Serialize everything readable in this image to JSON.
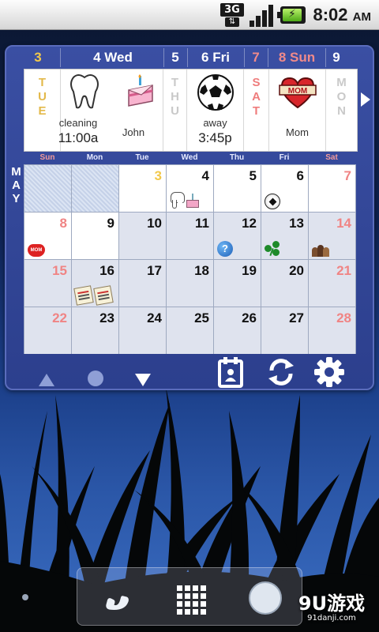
{
  "status_bar": {
    "network": "3G",
    "clock_time": "8:02",
    "clock_ampm": "AM"
  },
  "widget": {
    "day_headers": [
      {
        "label": "3",
        "style": "hl"
      },
      {
        "label": "4 Wed",
        "style": "normal"
      },
      {
        "label": "5",
        "style": "normal"
      },
      {
        "label": "6 Fri",
        "style": "normal"
      },
      {
        "label": "7",
        "style": "red"
      },
      {
        "label": "8 Sun",
        "style": "red"
      },
      {
        "label": "9",
        "style": "normal"
      }
    ],
    "strip": {
      "tue": {
        "day_vertical": "TUE"
      },
      "wed": {
        "icon": "tooth-icon",
        "label": "cleaning",
        "time": "11:00a",
        "second_icon": "birthday-cake-icon",
        "second_label": "John"
      },
      "thu": {
        "day_vertical": "THU"
      },
      "fri": {
        "icon": "soccer-ball-icon",
        "label": "away",
        "time": "3:45p"
      },
      "sat": {
        "day_vertical": "SAT"
      },
      "sun": {
        "icon": "mom-heart-icon",
        "icon_text": "MOM",
        "label": "Mom"
      },
      "mon": {
        "day_vertical": "MON"
      }
    },
    "month_label": "MAY",
    "weekdays": [
      "Sun",
      "Mon",
      "Tue",
      "Wed",
      "Thu",
      "Fri",
      "Sat"
    ],
    "calendar_rows": [
      [
        {
          "day": "",
          "state": "empty"
        },
        {
          "day": "",
          "state": "empty"
        },
        {
          "day": "3",
          "state": "today",
          "icons": []
        },
        {
          "day": "4",
          "state": "current",
          "icons": [
            "tooth-icon",
            "birthday-cake-icon"
          ]
        },
        {
          "day": "5",
          "state": "current",
          "icons": []
        },
        {
          "day": "6",
          "state": "current",
          "icons": [
            "soccer-ball-icon"
          ]
        },
        {
          "day": "7",
          "state": "current-weekend",
          "icons": []
        }
      ],
      [
        {
          "day": "8",
          "state": "current-weekend",
          "icons": [
            "mom-heart-icon"
          ]
        },
        {
          "day": "9",
          "state": "current",
          "icons": []
        },
        {
          "day": "10",
          "state": "future",
          "icons": []
        },
        {
          "day": "11",
          "state": "future",
          "icons": []
        },
        {
          "day": "12",
          "state": "future",
          "icons": [
            "question-icon"
          ]
        },
        {
          "day": "13",
          "state": "future",
          "icons": [
            "shamrock-icon"
          ]
        },
        {
          "day": "14",
          "state": "future-weekend",
          "icons": [
            "people-icon"
          ]
        }
      ],
      [
        {
          "day": "15",
          "state": "future-weekend",
          "icons": []
        },
        {
          "day": "16",
          "state": "future",
          "icons": [
            "notes-icon",
            "notes-icon"
          ]
        },
        {
          "day": "17",
          "state": "future",
          "icons": []
        },
        {
          "day": "18",
          "state": "future",
          "icons": []
        },
        {
          "day": "19",
          "state": "future",
          "icons": []
        },
        {
          "day": "20",
          "state": "future",
          "icons": []
        },
        {
          "day": "21",
          "state": "future-weekend",
          "icons": []
        }
      ],
      [
        {
          "day": "22",
          "state": "future-weekend",
          "icons": []
        },
        {
          "day": "23",
          "state": "future",
          "icons": []
        },
        {
          "day": "24",
          "state": "future",
          "icons": []
        },
        {
          "day": "25",
          "state": "future",
          "icons": []
        },
        {
          "day": "26",
          "state": "future",
          "icons": []
        },
        {
          "day": "27",
          "state": "future",
          "icons": []
        },
        {
          "day": "28",
          "state": "future-weekend",
          "icons": []
        }
      ]
    ],
    "controls": {
      "scroll_up": "triangle-up-icon",
      "today": "circle-icon",
      "scroll_down": "triangle-down-icon",
      "new_event": "calendar-add-icon",
      "sync": "refresh-icon",
      "settings": "gear-icon"
    }
  },
  "watermark": {
    "brand": "9U游戏",
    "url": "91danji.com"
  },
  "colors": {
    "widget_bg": "#2f4294",
    "today_accent": "#f2c84a",
    "weekend": "#f08484"
  }
}
